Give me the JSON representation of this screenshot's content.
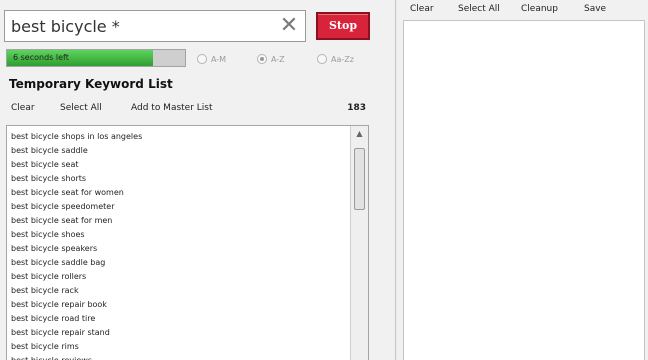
{
  "search": {
    "value": "best bicycle *",
    "clear_glyph": "✕",
    "stop_label": "Stop"
  },
  "progress": {
    "label": "6 seconds left",
    "fraction": 0.82
  },
  "sort": {
    "options": [
      {
        "label": "A-M",
        "checked": false
      },
      {
        "label": "A-Z",
        "checked": true
      },
      {
        "label": "Aa-Zz",
        "checked": false
      }
    ]
  },
  "temp_list": {
    "title": "Temporary Keyword List",
    "toolbar": {
      "clear": "Clear",
      "select_all": "Select All",
      "add_to_master": "Add to Master List"
    },
    "count": "183",
    "items": [
      "best bicycle shops in los angeles",
      "best bicycle saddle",
      "best bicycle seat",
      "best bicycle shorts",
      "best bicycle seat for women",
      "best bicycle speedometer",
      "best bicycle seat for men",
      "best bicycle shoes",
      "best bicycle speakers",
      "best bicycle saddle bag",
      "best bicycle rollers",
      "best bicycle rack",
      "best bicycle repair book",
      "best bicycle road tire",
      "best bicycle repair stand",
      "best bicycle rims",
      "best bicycle reviews"
    ]
  },
  "master_list": {
    "toolbar": {
      "clear": "Clear",
      "select_all": "Select All",
      "cleanup": "Cleanup",
      "save": "Save"
    }
  },
  "colors": {
    "stop_red": "#d8243a",
    "progress_green": "#3fb83f"
  }
}
